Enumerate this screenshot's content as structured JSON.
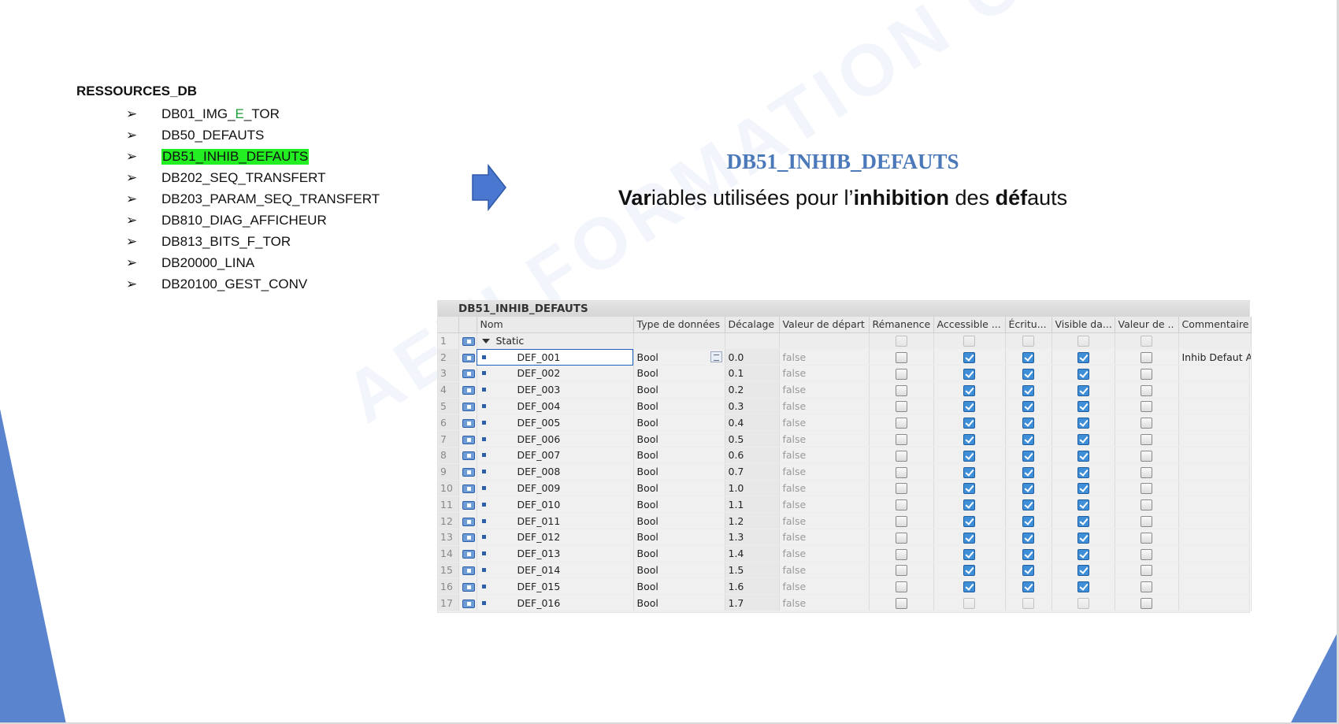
{
  "left_panel": {
    "title": "RESSOURCES_DB",
    "bullet": "➢",
    "items": [
      {
        "pre": "DB01_IMG_",
        "green": "E",
        "post": "_TOR"
      },
      {
        "pre": "DB50_DEFAUTS",
        "green": "",
        "post": ""
      },
      {
        "pre": "DB51_INHIB_DEFAUTS",
        "green": "",
        "post": ""
      },
      {
        "pre": "DB202_SEQ_TRANSFERT",
        "green": "",
        "post": ""
      },
      {
        "pre": "DB203_PARAM_SEQ_TRANSFERT",
        "green": "",
        "post": ""
      },
      {
        "pre": "DB810_DIAG_AFFICHEUR",
        "green": "",
        "post": ""
      },
      {
        "pre": "DB813_BITS_F_TOR",
        "green": "",
        "post": ""
      },
      {
        "pre": "DB20000_LINA",
        "green": "",
        "post": ""
      },
      {
        "pre": "DB20100_GEST_CONV",
        "green": "",
        "post": ""
      }
    ],
    "highlighted_index": 2,
    "highlight_color": "#22ee22"
  },
  "slide": {
    "title": "DB51_INHIB_DEFAUTS",
    "title_color": "#4a78b8",
    "subtitle_parts": [
      {
        "t": "Var",
        "b": true
      },
      {
        "t": "iables utilisées pour l’",
        "b": false
      },
      {
        "t": "inhibition",
        "b": true
      },
      {
        "t": " des ",
        "b": false
      },
      {
        "t": "déf",
        "b": true
      },
      {
        "t": "auts",
        "b": false
      }
    ],
    "watermark": "AETI FORMATION OUEST"
  },
  "table": {
    "title": "DB51_INHIB_DEFAUTS",
    "headers": [
      "Nom",
      "Type de données",
      "Décalage",
      "Valeur de départ",
      "Rémanence",
      "Accessible ...",
      "Écritu...",
      "Visible da...",
      "Valeur de ..",
      "Commentaire"
    ],
    "static_row": {
      "num": "1",
      "label": "Static"
    },
    "rows": [
      {
        "num": "2",
        "name": "DEF_001",
        "type": "Bool",
        "offset": "0.0",
        "start": "false",
        "remanence": false,
        "accessible": true,
        "write": true,
        "visible": true,
        "setpoint": false,
        "comment": "Inhib Defaut AU"
      },
      {
        "num": "3",
        "name": "DEF_002",
        "type": "Bool",
        "offset": "0.1",
        "start": "false",
        "remanence": false,
        "accessible": true,
        "write": true,
        "visible": true,
        "setpoint": false,
        "comment": ""
      },
      {
        "num": "4",
        "name": "DEF_003",
        "type": "Bool",
        "offset": "0.2",
        "start": "false",
        "remanence": false,
        "accessible": true,
        "write": true,
        "visible": true,
        "setpoint": false,
        "comment": ""
      },
      {
        "num": "5",
        "name": "DEF_004",
        "type": "Bool",
        "offset": "0.3",
        "start": "false",
        "remanence": false,
        "accessible": true,
        "write": true,
        "visible": true,
        "setpoint": false,
        "comment": ""
      },
      {
        "num": "6",
        "name": "DEF_005",
        "type": "Bool",
        "offset": "0.4",
        "start": "false",
        "remanence": false,
        "accessible": true,
        "write": true,
        "visible": true,
        "setpoint": false,
        "comment": ""
      },
      {
        "num": "7",
        "name": "DEF_006",
        "type": "Bool",
        "offset": "0.5",
        "start": "false",
        "remanence": false,
        "accessible": true,
        "write": true,
        "visible": true,
        "setpoint": false,
        "comment": ""
      },
      {
        "num": "8",
        "name": "DEF_007",
        "type": "Bool",
        "offset": "0.6",
        "start": "false",
        "remanence": false,
        "accessible": true,
        "write": true,
        "visible": true,
        "setpoint": false,
        "comment": ""
      },
      {
        "num": "9",
        "name": "DEF_008",
        "type": "Bool",
        "offset": "0.7",
        "start": "false",
        "remanence": false,
        "accessible": true,
        "write": true,
        "visible": true,
        "setpoint": false,
        "comment": ""
      },
      {
        "num": "10",
        "name": "DEF_009",
        "type": "Bool",
        "offset": "1.0",
        "start": "false",
        "remanence": false,
        "accessible": true,
        "write": true,
        "visible": true,
        "setpoint": false,
        "comment": ""
      },
      {
        "num": "11",
        "name": "DEF_010",
        "type": "Bool",
        "offset": "1.1",
        "start": "false",
        "remanence": false,
        "accessible": true,
        "write": true,
        "visible": true,
        "setpoint": false,
        "comment": ""
      },
      {
        "num": "12",
        "name": "DEF_011",
        "type": "Bool",
        "offset": "1.2",
        "start": "false",
        "remanence": false,
        "accessible": true,
        "write": true,
        "visible": true,
        "setpoint": false,
        "comment": ""
      },
      {
        "num": "13",
        "name": "DEF_012",
        "type": "Bool",
        "offset": "1.3",
        "start": "false",
        "remanence": false,
        "accessible": true,
        "write": true,
        "visible": true,
        "setpoint": false,
        "comment": ""
      },
      {
        "num": "14",
        "name": "DEF_013",
        "type": "Bool",
        "offset": "1.4",
        "start": "false",
        "remanence": false,
        "accessible": true,
        "write": true,
        "visible": true,
        "setpoint": false,
        "comment": ""
      },
      {
        "num": "15",
        "name": "DEF_014",
        "type": "Bool",
        "offset": "1.5",
        "start": "false",
        "remanence": false,
        "accessible": true,
        "write": true,
        "visible": true,
        "setpoint": false,
        "comment": ""
      },
      {
        "num": "16",
        "name": "DEF_015",
        "type": "Bool",
        "offset": "1.6",
        "start": "false",
        "remanence": false,
        "accessible": true,
        "write": true,
        "visible": true,
        "setpoint": false,
        "comment": ""
      },
      {
        "num": "17",
        "name": "DEF_016",
        "type": "Bool",
        "offset": "1.7",
        "start": "false",
        "remanence": false,
        "accessible": false,
        "write": false,
        "visible": false,
        "setpoint": false,
        "comment": ""
      }
    ],
    "selected_row": 0
  },
  "colors": {
    "accent_blue": "#4a78b8",
    "deco_blue": "#5b84cf"
  },
  "icons": [
    "arrow-right-icon",
    "db-variable-icon",
    "expand-triangle-icon",
    "checkbox-icon",
    "type-picker-icon"
  ]
}
